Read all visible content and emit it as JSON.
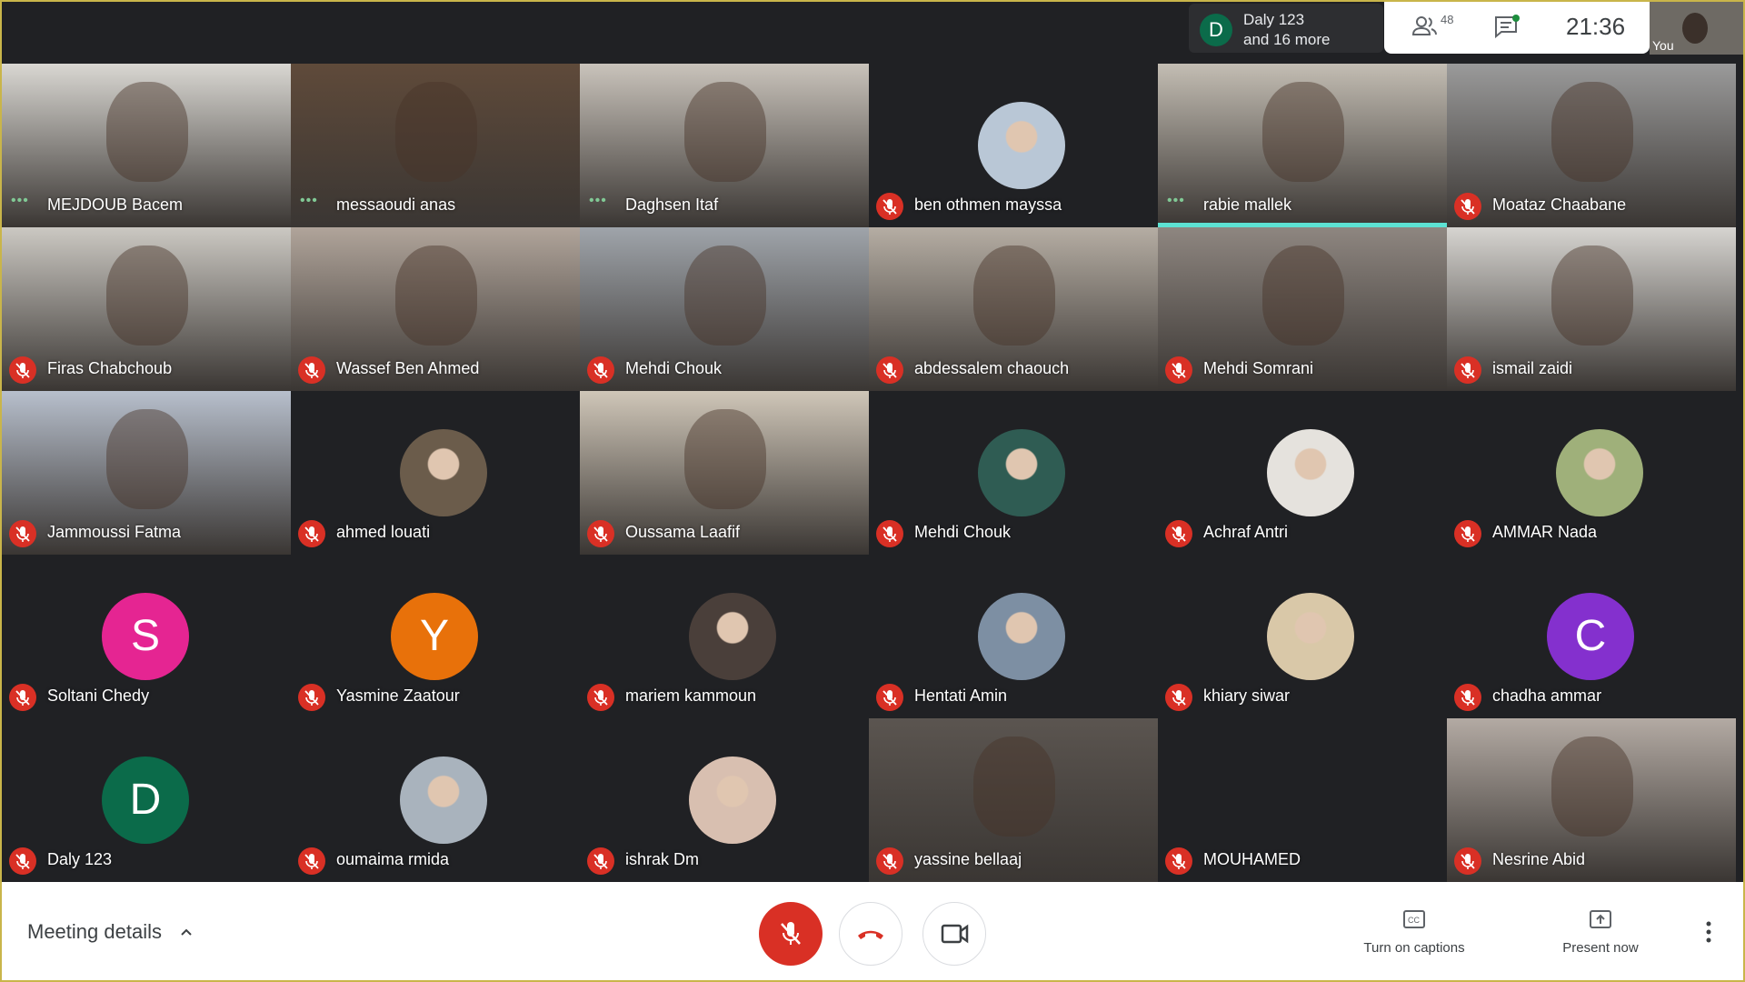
{
  "presence": {
    "initial": "D",
    "line1": "Daly 123",
    "line2": "and 16 more"
  },
  "top_controls": {
    "people_count": "48",
    "clock": "21:36",
    "self_label": "You"
  },
  "colors": {
    "mic_off": "#d93025",
    "speaking": "#5de2d3",
    "dots": "#81c995"
  },
  "participants": [
    {
      "name": "MEJDOUB Bacem",
      "state": "talking",
      "tile": "video",
      "bg": "#d9d7d2"
    },
    {
      "name": "messaoudi anas",
      "state": "talking",
      "tile": "video",
      "bg": "#5f4a3a"
    },
    {
      "name": "Daghsen Itaf",
      "state": "talking",
      "tile": "video",
      "bg": "#c9c3bb"
    },
    {
      "name": "ben othmen mayssa",
      "state": "muted",
      "tile": "photo",
      "bg": "#b9c7d6"
    },
    {
      "name": "rabie mallek",
      "state": "talking",
      "tile": "video",
      "bg": "#c3bdb3",
      "speaking": true
    },
    {
      "name": "Moataz Chaabane",
      "state": "muted",
      "tile": "video",
      "bg": "#9a9a9a"
    },
    {
      "name": "Firas Chabchoub",
      "state": "muted",
      "tile": "video",
      "bg": "#cbc8c2"
    },
    {
      "name": "Wassef Ben Ahmed",
      "state": "muted",
      "tile": "video",
      "bg": "#b0a49a"
    },
    {
      "name": "Mehdi Chouk",
      "state": "muted",
      "tile": "video",
      "bg": "#9fa4aa"
    },
    {
      "name": "abdessalem chaouch",
      "state": "muted",
      "tile": "video",
      "bg": "#b5ada3"
    },
    {
      "name": "Mehdi Somrani",
      "state": "muted",
      "tile": "video",
      "bg": "#8e8680"
    },
    {
      "name": "ismail zaidi",
      "state": "muted",
      "tile": "video",
      "bg": "#d6d4d0"
    },
    {
      "name": "Jammoussi Fatma",
      "state": "muted",
      "tile": "video",
      "bg": "#b7bfcc"
    },
    {
      "name": "ahmed louati",
      "state": "muted",
      "tile": "photo",
      "bg": "#6b5c4b"
    },
    {
      "name": "Oussama Laafif",
      "state": "muted",
      "tile": "video",
      "bg": "#cfc6b8"
    },
    {
      "name": "Mehdi Chouk",
      "state": "muted",
      "tile": "photo",
      "bg": "#2f5c53"
    },
    {
      "name": "Achraf Antri",
      "state": "muted",
      "tile": "photo",
      "bg": "#e5e2dd"
    },
    {
      "name": "AMMAR Nada",
      "state": "muted",
      "tile": "photo",
      "bg": "#9fb07a"
    },
    {
      "name": "Soltani Chedy",
      "state": "muted",
      "tile": "letter",
      "letter": "S",
      "bg": "#e52592"
    },
    {
      "name": "Yasmine Zaatour",
      "state": "muted",
      "tile": "letter",
      "letter": "Y",
      "bg": "#e8710a"
    },
    {
      "name": "mariem kammoun",
      "state": "muted",
      "tile": "photo",
      "bg": "#4a3f3a"
    },
    {
      "name": "Hentati Amin",
      "state": "muted",
      "tile": "photo",
      "bg": "#7d8fa3"
    },
    {
      "name": "khiary siwar",
      "state": "muted",
      "tile": "photo",
      "bg": "#d9c8a8"
    },
    {
      "name": "chadha ammar",
      "state": "muted",
      "tile": "letter",
      "letter": "C",
      "bg": "#8430ce"
    },
    {
      "name": "Daly 123",
      "state": "muted",
      "tile": "letter",
      "letter": "D",
      "bg": "#0b6b4a"
    },
    {
      "name": "oumaima rmida",
      "state": "muted",
      "tile": "photo",
      "bg": "#a9b3bd"
    },
    {
      "name": "ishrak Dm",
      "state": "muted",
      "tile": "photo",
      "bg": "#d8bfb0"
    },
    {
      "name": "yassine bellaaj",
      "state": "muted",
      "tile": "video",
      "bg": "#5b5550"
    },
    {
      "name": "MOUHAMED",
      "state": "muted",
      "tile": "blank",
      "bg": "#202124"
    },
    {
      "name": "Nesrine Abid",
      "state": "muted",
      "tile": "video",
      "bg": "#b3aaa3"
    }
  ],
  "bottom": {
    "meeting_details": "Meeting details",
    "captions": "Turn on captions",
    "present": "Present now"
  }
}
